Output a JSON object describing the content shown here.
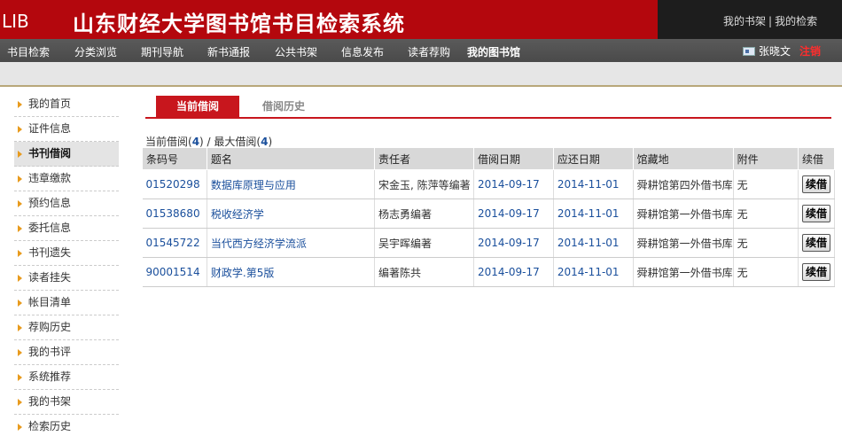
{
  "header": {
    "logo": "LIB",
    "title": "山东财经大学图书馆书目检索系统",
    "top_links": [
      "我的书架",
      "我的检索"
    ],
    "separator": "|"
  },
  "nav": {
    "items": [
      "书目检索",
      "分类浏览",
      "期刊导航",
      "新书通报",
      "公共书架",
      "信息发布",
      "读者荐购",
      "我的图书馆"
    ],
    "user_name": "张晓文",
    "logout": "注销"
  },
  "sidebar": {
    "items": [
      "我的首页",
      "证件信息",
      "书刊借阅",
      "违章缴款",
      "预约信息",
      "委托信息",
      "书刊遗失",
      "读者挂失",
      "帐目清单",
      "荐购历史",
      "我的书评",
      "系统推荐",
      "我的书架",
      "检索历史"
    ]
  },
  "tabs": [
    "当前借阅",
    "借阅历史"
  ],
  "borrow_summary": {
    "current_label": "当前借阅(",
    "current_count": "4",
    "middle": ") / 最大借阅(",
    "max_count": "4",
    "end": ")"
  },
  "table": {
    "headers": [
      "条码号",
      "题名",
      "责任者",
      "借阅日期",
      "应还日期",
      "馆藏地",
      "附件",
      "续借"
    ],
    "rows": [
      {
        "barcode": "01520298",
        "title": "数据库原理与应用",
        "author": "宋金玉, 陈萍等编著",
        "borrow_date": "2014-09-17",
        "due_date": "2014-11-01",
        "location": "舜耕馆第四外借书库",
        "attachment": "无",
        "renew": "续借"
      },
      {
        "barcode": "01538680",
        "title": "税收经济学",
        "author": "杨志勇编著",
        "borrow_date": "2014-09-17",
        "due_date": "2014-11-01",
        "location": "舜耕馆第一外借书库",
        "attachment": "无",
        "renew": "续借"
      },
      {
        "barcode": "01545722",
        "title": "当代西方经济学流派",
        "author": "吴宇晖编著",
        "borrow_date": "2014-09-17",
        "due_date": "2014-11-01",
        "location": "舜耕馆第一外借书库",
        "attachment": "无",
        "renew": "续借"
      },
      {
        "barcode": "90001514",
        "title": "财政学.第5版",
        "author": "编著陈共",
        "borrow_date": "2014-09-17",
        "due_date": "2014-11-01",
        "location": "舜耕馆第一外借书库",
        "attachment": "无",
        "renew": "续借"
      }
    ]
  },
  "colors": {
    "header_red": "#b4070d",
    "tab_red": "#c8161d",
    "link_blue": "#1a4f9c",
    "logout_red": "#ff2d2d"
  }
}
